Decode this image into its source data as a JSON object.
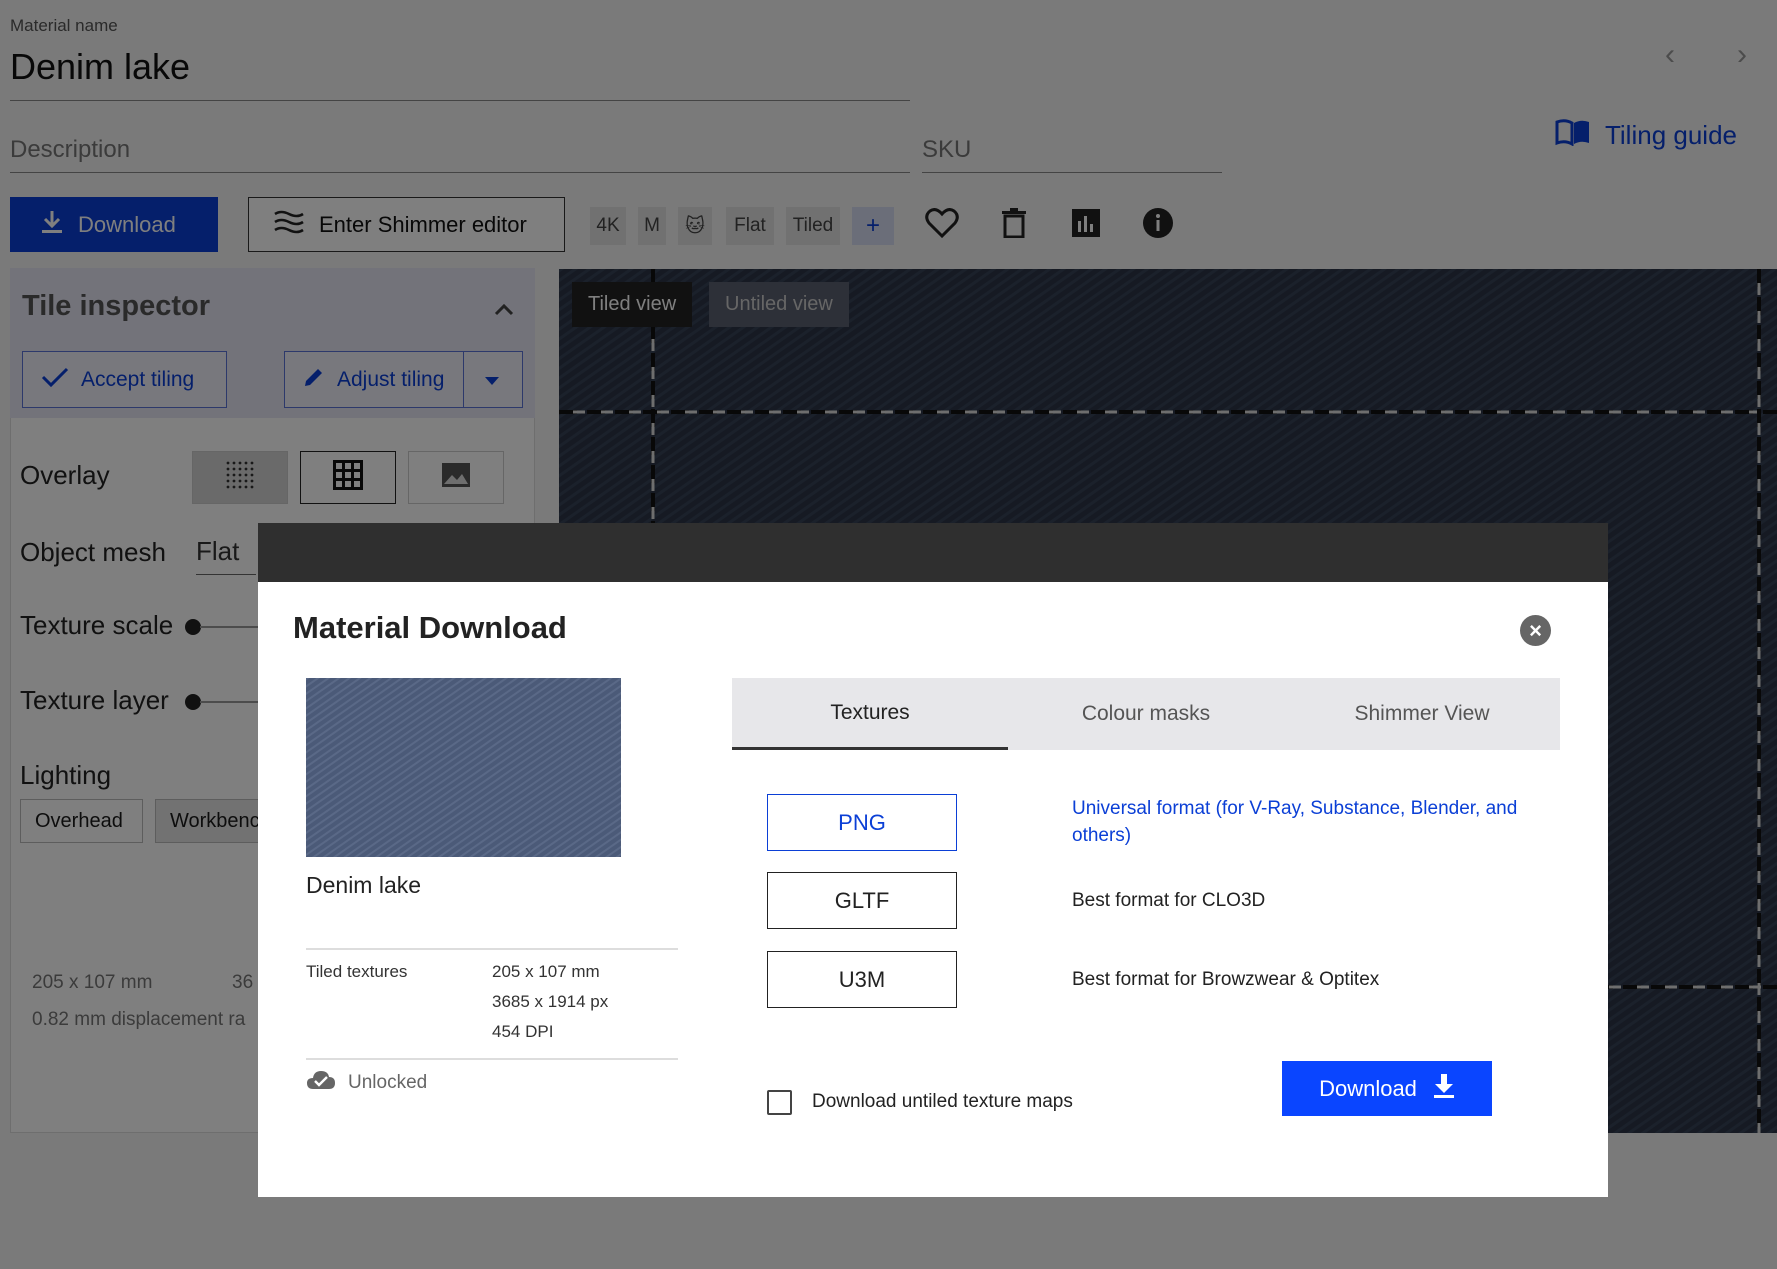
{
  "header": {
    "material_name_label": "Material name",
    "material_name": "Denim lake",
    "description_placeholder": "Description",
    "sku_placeholder": "SKU",
    "tiling_guide": "Tiling guide"
  },
  "toolbar": {
    "download": "Download",
    "shimmer_editor": "Enter Shimmer editor",
    "chips": [
      "4K",
      "M",
      "🐱",
      "Flat",
      "Tiled",
      "+"
    ]
  },
  "inspector": {
    "title": "Tile inspector",
    "accept_tiling": "Accept tiling",
    "adjust_tiling": "Adjust tiling",
    "overlay_label": "Overlay",
    "object_mesh_label": "Object mesh",
    "object_mesh_value": "Flat",
    "texture_scale_label": "Texture scale",
    "texture_layer_label": "Texture layer",
    "lighting_label": "Lighting",
    "lighting_options": [
      "Overhead",
      "Workbenc"
    ],
    "size_mm": "205 x 107 mm",
    "size_extra": "36",
    "displacement": "0.82 mm displacement ra"
  },
  "viewport": {
    "tiled_view": "Tiled view",
    "untiled_view": "Untiled view"
  },
  "dialog": {
    "title": "Material Download",
    "material_name": "Denim lake",
    "spec_label": "Tiled textures",
    "spec_values": [
      "205 x 107 mm",
      "3685 x 1914 px",
      "454 DPI"
    ],
    "status": "Unlocked",
    "tabs": [
      "Textures",
      "Colour masks",
      "Shimmer View"
    ],
    "active_tab": "Textures",
    "formats": [
      {
        "name": "PNG",
        "desc": "Universal format (for V-Ray, Substance, Blender, and others)",
        "selected": true
      },
      {
        "name": "GLTF",
        "desc": "Best format for CLO3D",
        "selected": false
      },
      {
        "name": "U3M",
        "desc": "Best format for Browzwear & Optitex",
        "selected": false
      }
    ],
    "untiled_checkbox_label": "Download untiled texture maps",
    "untiled_checked": false,
    "download_button": "Download"
  },
  "colors": {
    "primary": "#0b3fd6",
    "download_bright": "#0a45ff",
    "denim": "#2c3546"
  }
}
